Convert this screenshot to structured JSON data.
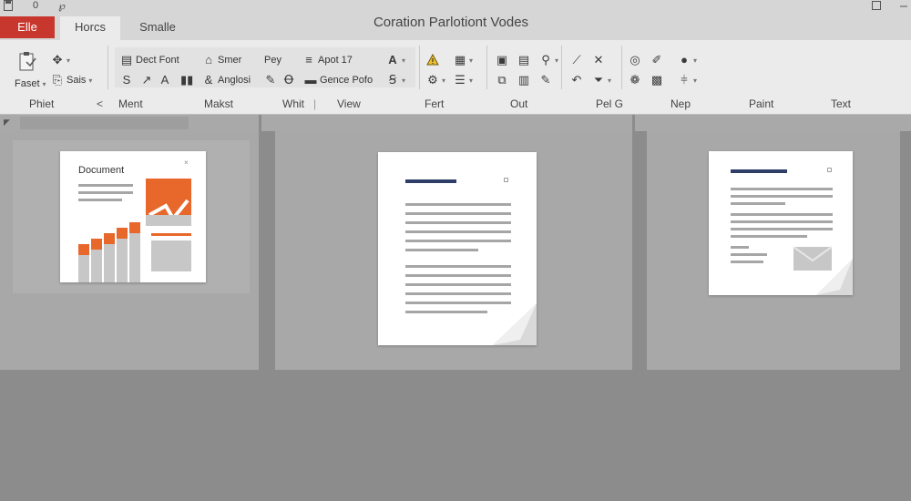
{
  "quick_access": {
    "save_icon": "save-icon",
    "undo": "0",
    "redo": "℘"
  },
  "tabs": {
    "file": "Elle",
    "home": "Horcs",
    "third": "Smalle"
  },
  "window": {
    "title": "Coration Parlotiont Vodes"
  },
  "ribbon": {
    "clipboard": {
      "paste": "Faset",
      "cut": "Sais"
    },
    "font": {
      "font_name": "Dect Font",
      "smer": "Smer",
      "pey": "Pey",
      "size": "Apot 17",
      "style": "Anglosi",
      "genre": "Gence Pofo"
    }
  },
  "groups": [
    "Phiet",
    "Ment",
    "Makst",
    "Whit",
    "View",
    "Fert",
    "Out",
    "Pel G",
    "Nep",
    "Paint",
    "Text"
  ],
  "thumbnails": {
    "doc1": {
      "heading": "Document"
    }
  },
  "colors": {
    "file_tab": "#c8372e",
    "chart_orange": "#e8672b",
    "accent_navy": "#2f3e66"
  }
}
